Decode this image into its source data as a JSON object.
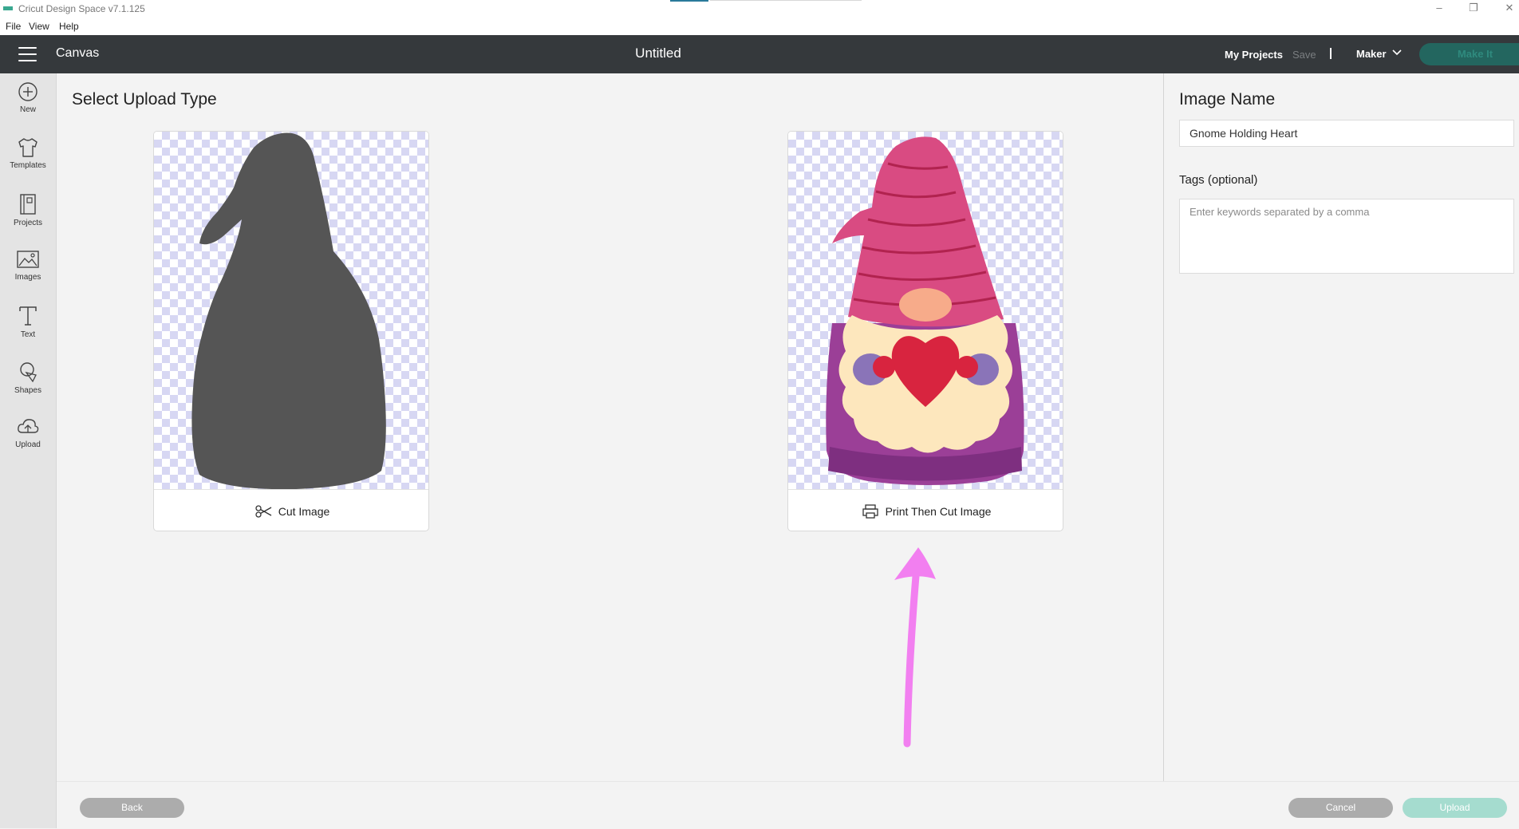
{
  "window": {
    "app_title": "Cricut Design Space  v7.1.125",
    "controls": [
      "minimize-icon",
      "restore-icon",
      "close-icon"
    ]
  },
  "menu": [
    "File",
    "View",
    "Help"
  ],
  "header": {
    "section": "Canvas",
    "document_title": "Untitled",
    "my_projects": "My Projects",
    "save": "Save",
    "machine": "Maker",
    "make_it": "Make It",
    "colors": {
      "bar": "#35393c",
      "make_it_bg": "#23665f"
    }
  },
  "sidebar": {
    "items": [
      {
        "label": "New",
        "icon": "plus-circle-icon"
      },
      {
        "label": "Templates",
        "icon": "tshirt-icon"
      },
      {
        "label": "Projects",
        "icon": "projects-book-icon"
      },
      {
        "label": "Images",
        "icon": "image-icon"
      },
      {
        "label": "Text",
        "icon": "text-t-icon"
      },
      {
        "label": "Shapes",
        "icon": "shapes-icon"
      },
      {
        "label": "Upload",
        "icon": "cloud-upload-icon"
      }
    ]
  },
  "main": {
    "heading": "Select Upload Type",
    "cards": [
      {
        "label": "Cut Image",
        "icon": "scissors-icon",
        "preview": "gnome-silhouette"
      },
      {
        "label": "Print Then Cut Image",
        "icon": "printer-icon",
        "preview": "gnome-color"
      }
    ],
    "annotation": {
      "type": "arrow",
      "color": "#f27ff0",
      "points_to": "Print Then Cut Image"
    }
  },
  "panel": {
    "image_name_label": "Image Name",
    "image_name_value": "Gnome Holding Heart",
    "tags_label": "Tags (optional)",
    "tags_placeholder": "Enter keywords separated by a comma"
  },
  "footer": {
    "back": "Back",
    "cancel": "Cancel",
    "upload": "Upload"
  },
  "colors": {
    "accent_teal": "#a5dccf",
    "checker": "#d7d7f3",
    "silhouette": "#555555",
    "hat": "#d94b82",
    "body": "#9b3f97",
    "beard": "#fde7bd",
    "heart": "#d8243f"
  }
}
